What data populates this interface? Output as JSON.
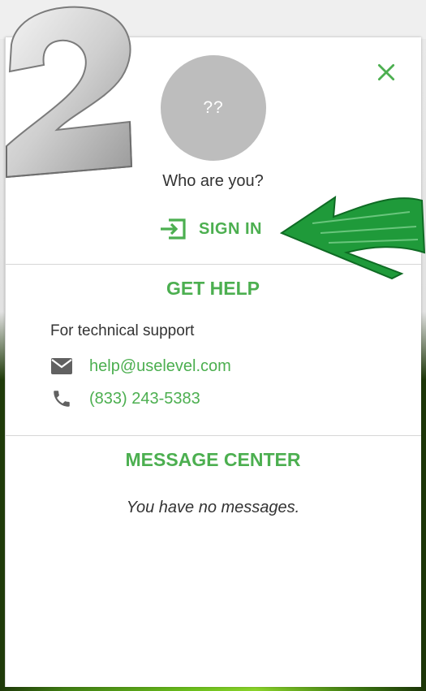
{
  "avatar": {
    "initials": "??"
  },
  "header": {
    "prompt": "Who are you?",
    "sign_in_label": "SIGN IN"
  },
  "get_help": {
    "title": "GET HELP",
    "support_text": "For technical support",
    "email": "help@uselevel.com",
    "phone": "(833) 243-5383"
  },
  "message_center": {
    "title": "MESSAGE CENTER",
    "empty_text": "You have no messages."
  },
  "colors": {
    "accent": "#4caf50",
    "avatar_bg": "#bdbdbd",
    "text": "#333333",
    "icon_gray": "#616161"
  },
  "icons": {
    "close": "close-icon",
    "sign_in": "login-icon",
    "email": "mail-icon",
    "phone": "phone-icon"
  },
  "annotations": {
    "step_number": "2"
  }
}
